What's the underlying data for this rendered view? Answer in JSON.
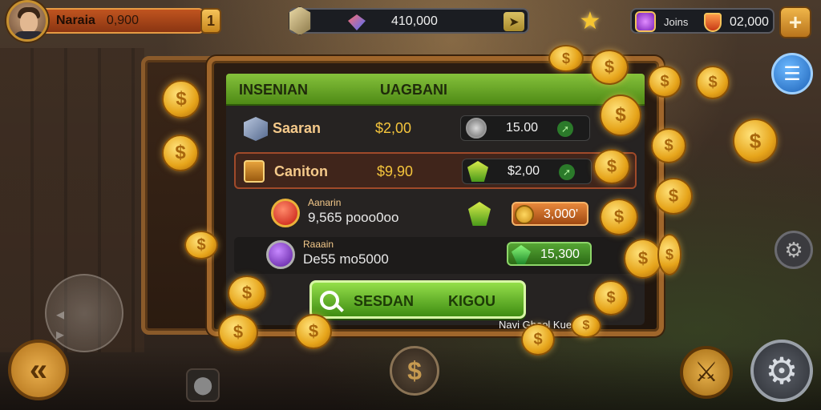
{
  "player": {
    "name": "Naraia",
    "amount": "0,900",
    "end_symbol": "1"
  },
  "currency": {
    "value": "410,000",
    "arrow": "➤"
  },
  "gems": {
    "label": "Joins",
    "value": "02,000",
    "add_symbol": "+"
  },
  "shop": {
    "header_left": "INSENIAN",
    "header_right": "UAGBANI",
    "rows": [
      {
        "name": "Saaran",
        "price": "$2,00",
        "cost": "15.00"
      },
      {
        "name": "Caniton",
        "price": "$9,90",
        "cost": "$2,00"
      },
      {
        "tiny": "Aanarin",
        "code": "9,565 pooo0oo",
        "cost": "3,000'"
      },
      {
        "tiny": "Raaain",
        "code": "De55 mo5000",
        "cost": "15,300"
      }
    ],
    "search_button": {
      "left_label": "SESDAN",
      "right_label": "KIGOU"
    },
    "footer_note": "Navi Ghool Kue"
  },
  "icons": {
    "menu": "menu-icon",
    "settings": "gear-icon",
    "sword": "sword-icon",
    "back": "back-arrow-icon",
    "coin": "coin-icon"
  },
  "colors": {
    "accent_green": "#5aa61e",
    "accent_gold": "#f5c53c",
    "frame_wood": "#a0662b"
  }
}
